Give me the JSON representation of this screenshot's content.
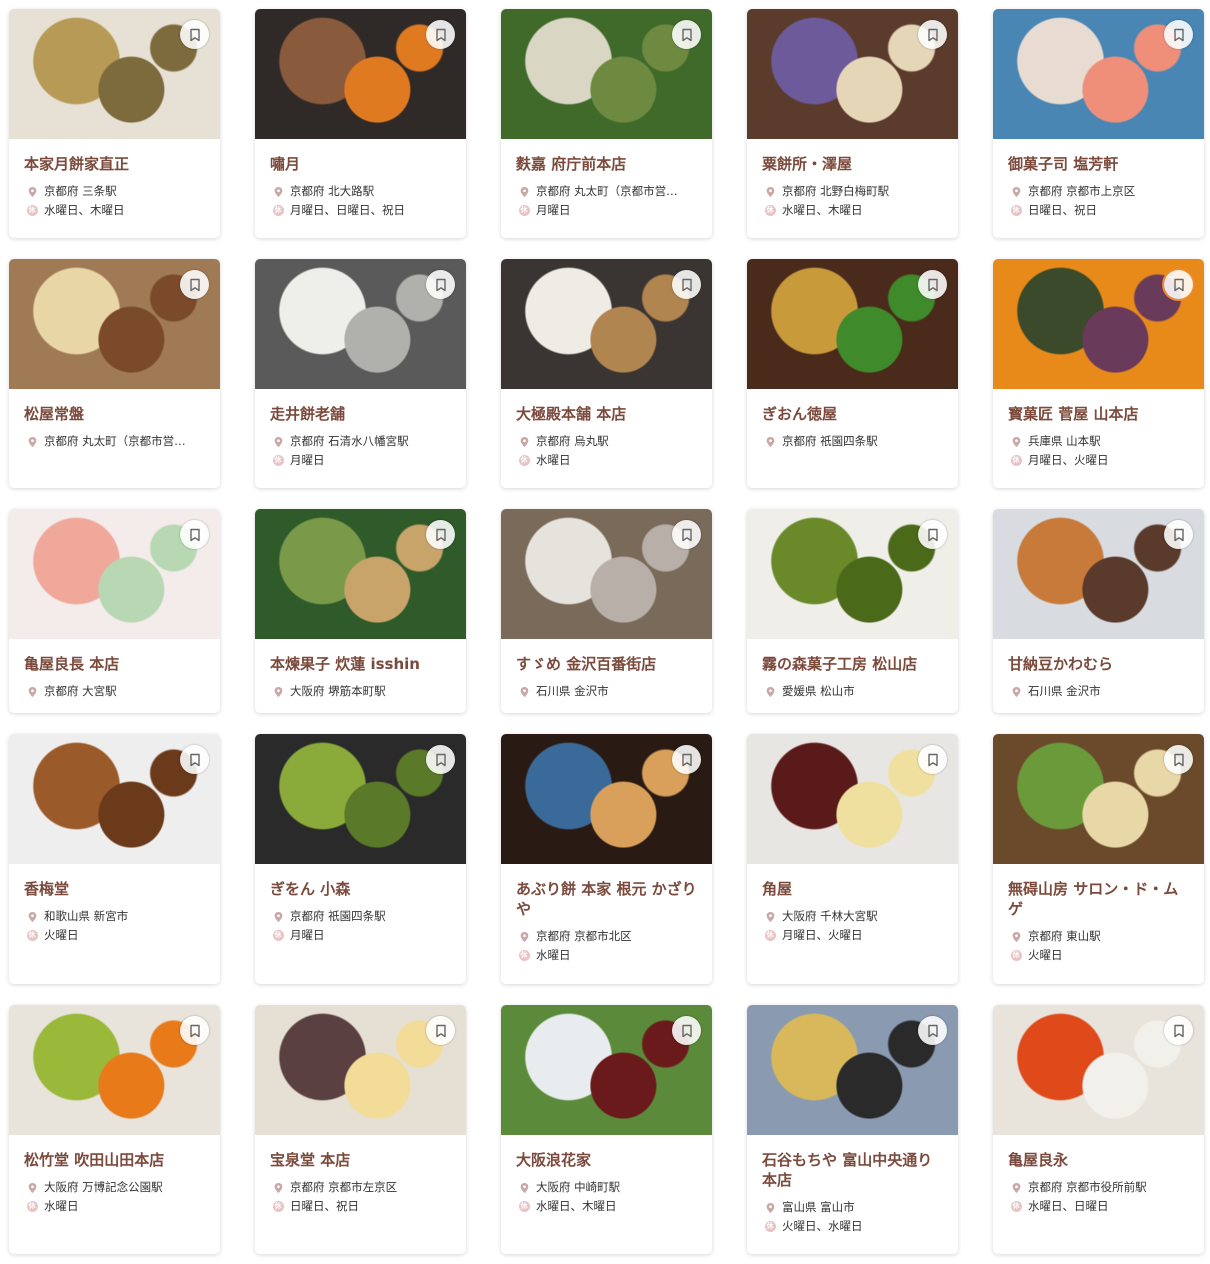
{
  "colors": {
    "name": "#7b4a3c",
    "icon": "#c9a8a8"
  },
  "shops": [
    {
      "name": "本家月餅家直正",
      "location": "京都府 三条駅",
      "holiday": "水曜日、木曜日",
      "palette": [
        "#e6e1d4",
        "#b79a55",
        "#7d6a3d"
      ],
      "bookmark_active": false
    },
    {
      "name": "嘯月",
      "location": "京都府 北大路駅",
      "holiday": "月曜日、日曜日、祝日",
      "palette": [
        "#2f2a28",
        "#8a5a3c",
        "#e07a21"
      ],
      "bookmark_active": false
    },
    {
      "name": "麩嘉 府庁前本店",
      "location": "京都府 丸太町（京都市営…",
      "holiday": "月曜日",
      "palette": [
        "#3f6a2a",
        "#d9d7c4",
        "#6e8a40"
      ],
      "bookmark_active": false
    },
    {
      "name": "粟餅所・澤屋",
      "location": "京都府 北野白梅町駅",
      "holiday": "水曜日、木曜日",
      "palette": [
        "#5b3b2c",
        "#6d5a9a",
        "#e5d6b8"
      ],
      "bookmark_active": false
    },
    {
      "name": "御菓子司 塩芳軒",
      "location": "京都府 京都市上京区",
      "holiday": "日曜日、祝日",
      "palette": [
        "#4a86b4",
        "#e8dcd2",
        "#ef8f7a"
      ],
      "bookmark_active": false
    },
    {
      "name": "松屋常盤",
      "location": "京都府 丸太町（京都市営…",
      "holiday": "",
      "palette": [
        "#a07a55",
        "#e9d6a6",
        "#7a4a2a"
      ],
      "bookmark_active": false
    },
    {
      "name": "走井餅老舗",
      "location": "京都府 石清水八幡宮駅",
      "holiday": "月曜日",
      "palette": [
        "#5a5a5a",
        "#eeeeea",
        "#b0b0ac"
      ],
      "bookmark_active": false
    },
    {
      "name": "大極殿本舗 本店",
      "location": "京都府 烏丸駅",
      "holiday": "水曜日",
      "palette": [
        "#3a3532",
        "#efece6",
        "#b08550"
      ],
      "bookmark_active": false
    },
    {
      "name": "ぎおん徳屋",
      "location": "京都府 祇園四条駅",
      "holiday": "",
      "palette": [
        "#4a2a1a",
        "#c89a3a",
        "#3f8a2a"
      ],
      "bookmark_active": false
    },
    {
      "name": "寳菓匠 菅屋 山本店",
      "location": "兵庫県 山本駅",
      "holiday": "月曜日、火曜日",
      "palette": [
        "#e88a1a",
        "#3a4a2a",
        "#6a3a5a"
      ],
      "bookmark_active": true
    },
    {
      "name": "亀屋良長 本店",
      "location": "京都府 大宮駅",
      "holiday": "",
      "palette": [
        "#f4ecea",
        "#f0a89a",
        "#b8d8b4"
      ],
      "bookmark_active": false
    },
    {
      "name": "本煉果子 炊蓮 isshin",
      "location": "大阪府 堺筋本町駅",
      "holiday": "",
      "palette": [
        "#2f5a2a",
        "#7a9a4a",
        "#c8a46a"
      ],
      "bookmark_active": false
    },
    {
      "name": "すゞめ 金沢百番街店",
      "location": "石川県 金沢市",
      "holiday": "",
      "palette": [
        "#7a6a5a",
        "#e6e2dc",
        "#b8b0a8"
      ],
      "bookmark_active": false
    },
    {
      "name": "霧の森菓子工房 松山店",
      "location": "愛媛県 松山市",
      "holiday": "",
      "palette": [
        "#efeee8",
        "#6a8a2a",
        "#4a6a1a"
      ],
      "bookmark_active": false
    },
    {
      "name": "甘納豆かわむら",
      "location": "石川県 金沢市",
      "holiday": "",
      "palette": [
        "#d8dce0",
        "#c87a3a",
        "#5a3a2a"
      ],
      "bookmark_active": false
    },
    {
      "name": "香梅堂",
      "location": "和歌山県 新宮市",
      "holiday": "火曜日",
      "palette": [
        "#efeeee",
        "#9a5a2a",
        "#6a3a1a"
      ],
      "bookmark_active": false
    },
    {
      "name": "ぎをん 小森",
      "location": "京都府 祇園四条駅",
      "holiday": "月曜日",
      "palette": [
        "#2a2a2a",
        "#8aaa3a",
        "#5a7a2a"
      ],
      "bookmark_active": false
    },
    {
      "name": "あぶり餅 本家 根元 かざりや",
      "location": "京都府 京都市北区",
      "holiday": "水曜日",
      "palette": [
        "#2a1a14",
        "#3a6a9a",
        "#d8a05a"
      ],
      "bookmark_active": false
    },
    {
      "name": "角屋",
      "location": "大阪府 千林大宮駅",
      "holiday": "月曜日、火曜日",
      "palette": [
        "#e8e6e2",
        "#5a1a1a",
        "#f0e0a0"
      ],
      "bookmark_active": false
    },
    {
      "name": "無碍山房 サロン・ド・ムゲ",
      "location": "京都府 東山駅",
      "holiday": "火曜日",
      "palette": [
        "#6a4a2a",
        "#6a9a3a",
        "#e8d8a8"
      ],
      "bookmark_active": false
    },
    {
      "name": "松竹堂 吹田山田本店",
      "location": "大阪府 万博記念公園駅",
      "holiday": "水曜日",
      "palette": [
        "#e8e4dc",
        "#9ab83a",
        "#e87a1a"
      ],
      "bookmark_active": false
    },
    {
      "name": "宝泉堂 本店",
      "location": "京都府 京都市左京区",
      "holiday": "日曜日、祝日",
      "palette": [
        "#e6e0d4",
        "#5a4040",
        "#f2dc98"
      ],
      "bookmark_active": false
    },
    {
      "name": "大阪浪花家",
      "location": "大阪府 中崎町駅",
      "holiday": "水曜日、木曜日",
      "palette": [
        "#5a8a3a",
        "#e8ecee",
        "#6a1a1a"
      ],
      "bookmark_active": false
    },
    {
      "name": "石谷もちや 富山中央通り本店",
      "location": "富山県 富山市",
      "holiday": "火曜日、水曜日",
      "palette": [
        "#8a9ab0",
        "#d8b85a",
        "#2a2a2a"
      ],
      "bookmark_active": false
    },
    {
      "name": "亀屋良永",
      "location": "京都府 京都市役所前駅",
      "holiday": "水曜日、日曜日",
      "palette": [
        "#e8e4dc",
        "#e04a1a",
        "#f2f0ea"
      ],
      "bookmark_active": false
    }
  ]
}
